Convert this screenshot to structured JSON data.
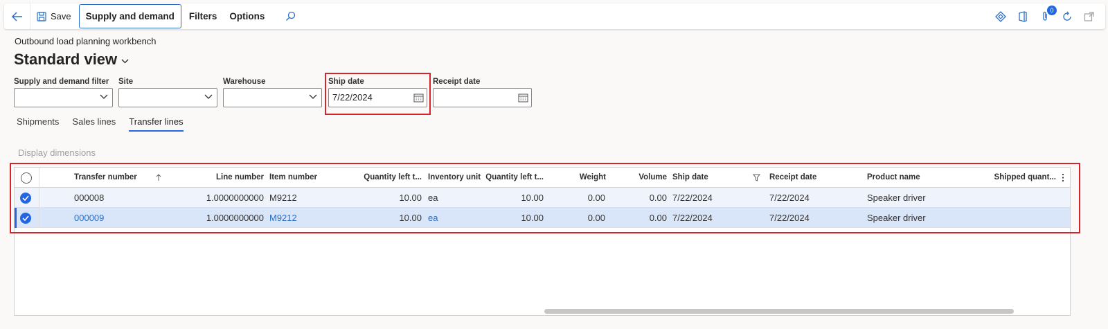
{
  "toolbar": {
    "save_label": "Save",
    "supply_demand_label": "Supply and demand",
    "filters_label": "Filters",
    "options_label": "Options",
    "notification_count": "0"
  },
  "page": {
    "breadcrumb": "Outbound load planning workbench",
    "view_title": "Standard view"
  },
  "filters": {
    "supply_demand_filter": {
      "label": "Supply and demand filter",
      "value": ""
    },
    "site": {
      "label": "Site",
      "value": ""
    },
    "warehouse": {
      "label": "Warehouse",
      "value": ""
    },
    "ship_date": {
      "label": "Ship date",
      "value": "7/22/2024"
    },
    "receipt_date": {
      "label": "Receipt date",
      "value": ""
    }
  },
  "tabs": [
    {
      "label": "Shipments",
      "active": false
    },
    {
      "label": "Sales lines",
      "active": false
    },
    {
      "label": "Transfer lines",
      "active": true
    }
  ],
  "display_dimensions_label": "Display dimensions",
  "grid": {
    "columns": {
      "transfer_number": "Transfer number",
      "line_number": "Line number",
      "item_number": "Item number",
      "qty_left_1": "Quantity left t...",
      "inventory_unit": "Inventory unit",
      "qty_left_2": "Quantity left t...",
      "weight": "Weight",
      "volume": "Volume",
      "ship_date": "Ship date",
      "receipt_date": "Receipt date",
      "product_name": "Product name",
      "shipped_qty": "Shipped quant..."
    },
    "rows": [
      {
        "transfer_number": "000008",
        "line_number": "1.0000000000",
        "item_number": "M9212",
        "qty_left_1": "10.00",
        "inventory_unit": "ea",
        "qty_left_2": "10.00",
        "weight": "0.00",
        "volume": "0.00",
        "ship_date": "7/22/2024",
        "receipt_date": "7/22/2024",
        "product_name": "Speaker driver",
        "selected": true
      },
      {
        "transfer_number": "000009",
        "line_number": "1.0000000000",
        "item_number": "M9212",
        "qty_left_1": "10.00",
        "inventory_unit": "ea",
        "qty_left_2": "10.00",
        "weight": "0.00",
        "volume": "0.00",
        "ship_date": "7/22/2024",
        "receipt_date": "7/22/2024",
        "product_name": "Speaker driver",
        "selected": true
      }
    ]
  },
  "colors": {
    "accent": "#2266e3",
    "highlight_border": "#d8232a",
    "link": "#2a6ec4"
  }
}
